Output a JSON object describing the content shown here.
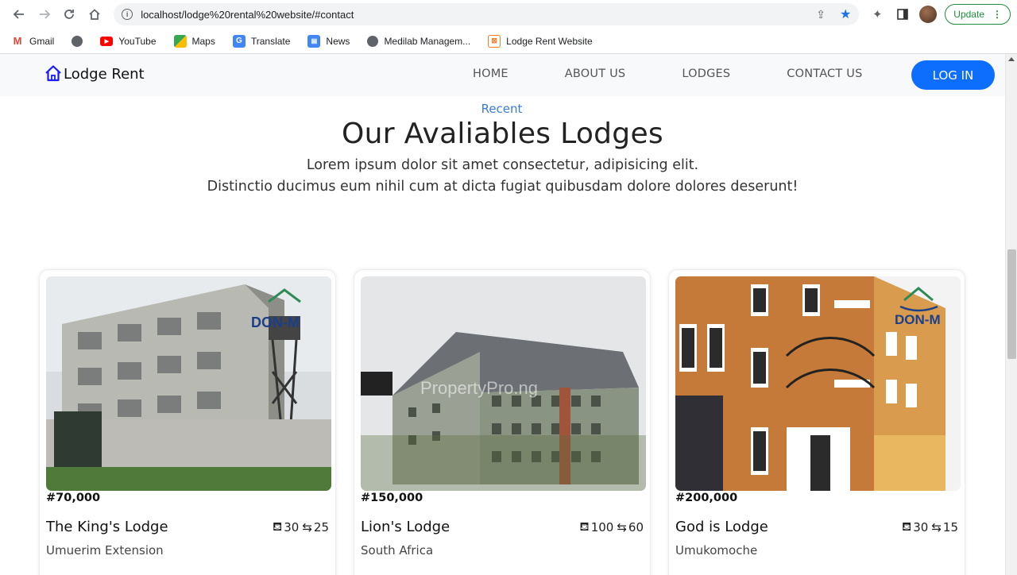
{
  "browser": {
    "url": "localhost/lodge%20rental%20website/#contact",
    "update_label": "Update",
    "bookmarks": [
      "Gmail",
      "YouTube",
      "Maps",
      "Translate",
      "News",
      "Medilab Managem...",
      "Lodge Rent Website"
    ]
  },
  "site": {
    "brand": "Lodge Rent",
    "menu": [
      "HOME",
      "ABOUT US",
      "LODGES",
      "CONTACT US"
    ],
    "login": "LOG IN",
    "accent": "#0d6efd"
  },
  "section": {
    "eyebrow": "Recent",
    "title": "Our Avaliables Lodges",
    "desc_line1": "Lorem ipsum dolor sit amet consectetur, adipisicing elit.",
    "desc_line2": "Distinctio ducimus eum nihil cum at dicta fugiat quibusdam dolore dolores deserunt!"
  },
  "lodges": [
    {
      "price": "#70,000",
      "name": "The King's Lodge",
      "beds": "30",
      "baths": "25",
      "location": "Umuerim Extension",
      "watermark": "DON-M"
    },
    {
      "price": "#150,000",
      "name": "Lion's Lodge",
      "beds": "100",
      "baths": "60",
      "location": "South Africa",
      "watermark": "PropertyPro.ng"
    },
    {
      "price": "#200,000",
      "name": "God is Lodge",
      "beds": "30",
      "baths": "15",
      "location": "Umukomoche",
      "watermark": "DON-M"
    }
  ]
}
